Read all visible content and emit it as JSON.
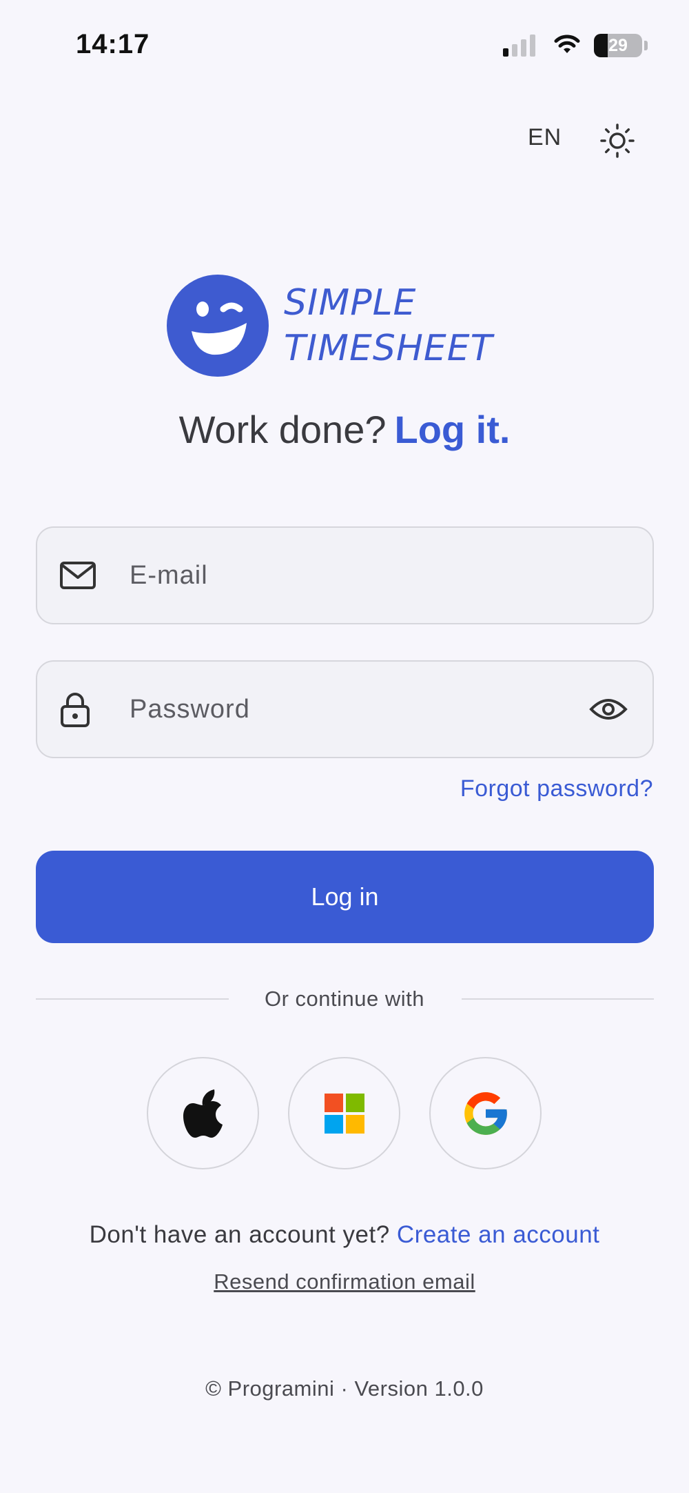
{
  "status_bar": {
    "time": "14:17",
    "battery_percent": "29",
    "battery_level": 0.29,
    "signal_bars_active": 1,
    "signal_bars_total": 4
  },
  "header": {
    "language": "EN",
    "theme_icon": "sun-icon"
  },
  "logo": {
    "line1": "SIMPLE",
    "line2": "TIMESHEET",
    "icon": "winking-smiley-logo",
    "color": "#3e5bd0"
  },
  "tagline": {
    "text": "Work done?",
    "accent": "Log it."
  },
  "form": {
    "email": {
      "placeholder": "E-mail",
      "value": "",
      "icon": "mail-icon"
    },
    "password": {
      "placeholder": "Password",
      "value": "",
      "icon": "lock-icon",
      "toggle_icon": "eye-icon"
    },
    "forgot_label": "Forgot password?",
    "login_label": "Log in"
  },
  "social": {
    "divider_label": "Or continue with",
    "providers": [
      {
        "name": "apple",
        "icon": "apple-icon"
      },
      {
        "name": "microsoft",
        "icon": "microsoft-icon"
      },
      {
        "name": "google",
        "icon": "google-icon"
      }
    ]
  },
  "signup": {
    "prompt": "Don't have an account yet?",
    "link": "Create an account",
    "resend": "Resend confirmation email"
  },
  "footer": {
    "text": "© Programini · Version 1.0.0"
  },
  "colors": {
    "accent": "#3a5bd4",
    "background": "#f7f6fc",
    "field_background": "#f2f2f7"
  }
}
